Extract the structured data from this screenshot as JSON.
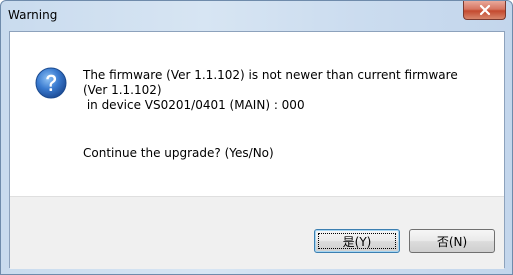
{
  "window": {
    "title": "Warning"
  },
  "dialog": {
    "icon": "question-icon",
    "message": "The firmware (Ver 1.1.102) is not newer than current firmware\n(Ver 1.1.102)\n in device VS0201/0401 (MAIN) : 000",
    "question": "Continue the upgrade? (Yes/No)"
  },
  "buttons": {
    "yes_label": "是(Y)",
    "no_label": "否(N)"
  },
  "colors": {
    "icon_blue": "#2a64b3",
    "close_red": "#c44a2f"
  }
}
